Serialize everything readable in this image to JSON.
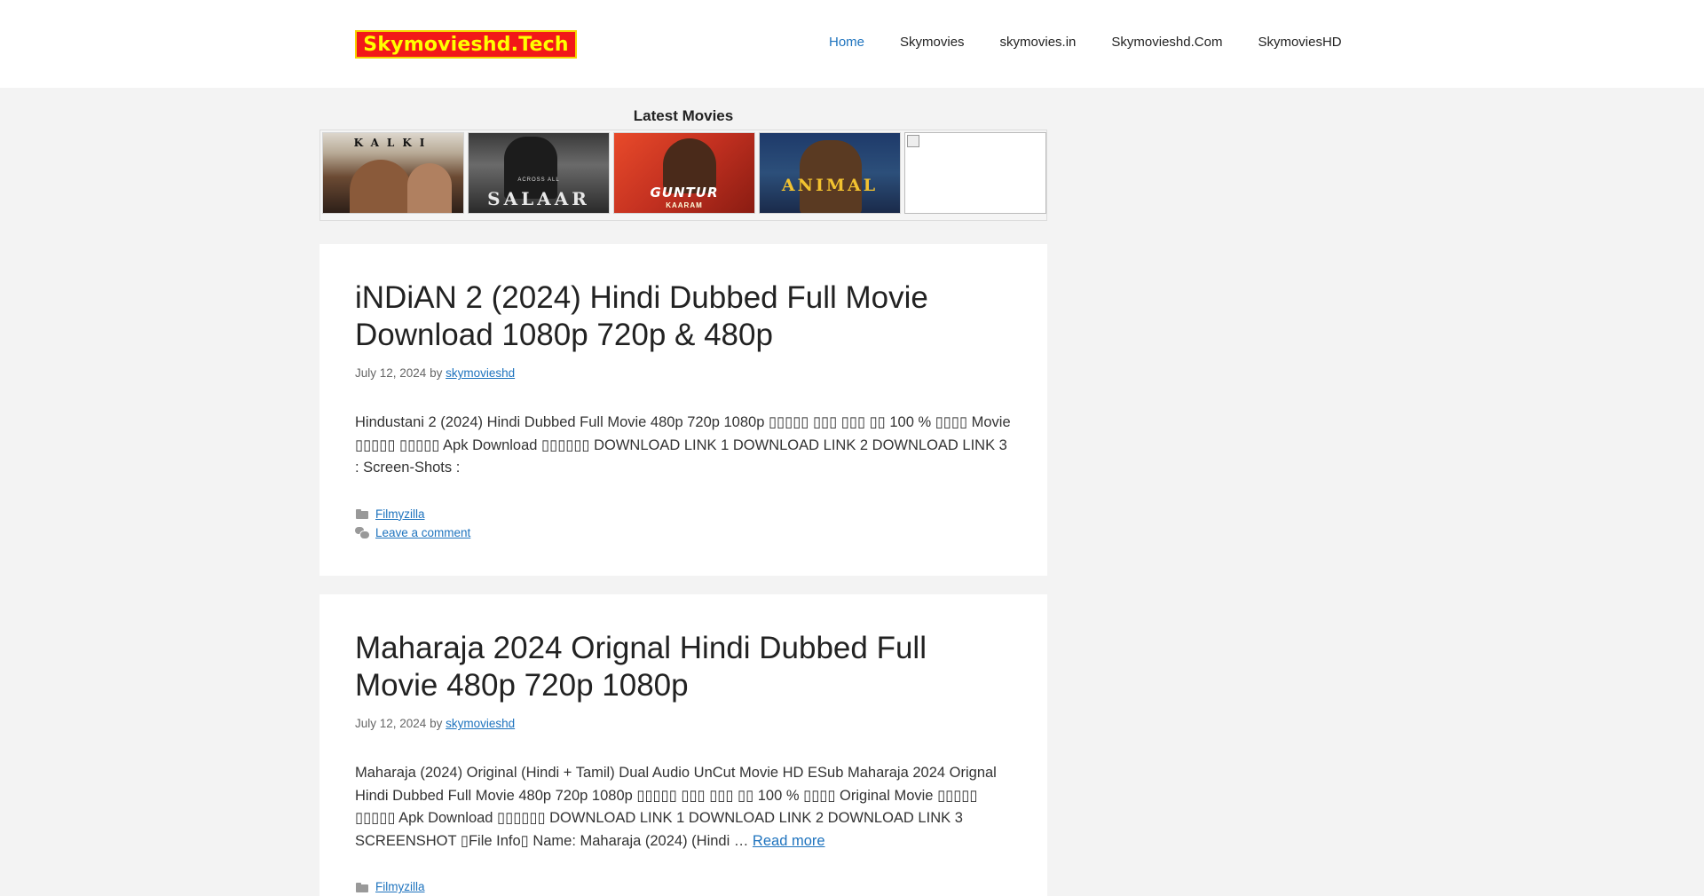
{
  "header": {
    "logo_text": "Skymovieshd.Tech",
    "nav": [
      {
        "label": "Home",
        "active": true
      },
      {
        "label": "Skymovies"
      },
      {
        "label": "skymovies.in"
      },
      {
        "label": "Skymovieshd.Com"
      },
      {
        "label": "SkymoviesHD"
      }
    ]
  },
  "latest": {
    "title": "Latest Movies",
    "posters": [
      {
        "name": "Kalki",
        "text": "KALKI"
      },
      {
        "name": "Salaar",
        "text": "SALAAR",
        "tagline": "ACROSS ALL"
      },
      {
        "name": "Guntur Kaaram",
        "text": "GUNTUR",
        "sub": "KAARAM"
      },
      {
        "name": "Animal",
        "text": "ANIMAL"
      },
      {
        "name": "broken-image"
      }
    ]
  },
  "posts": [
    {
      "title": "iNDiAN 2 (2024) Hindi Dubbed Full Movie Download 1080p 720p & 480p",
      "date": "July 12, 2024",
      "by": "by",
      "author": "skymovieshd",
      "excerpt": "Hindustani 2 (2024) Hindi Dubbed Full Movie 480p 720p 1080p ▯▯▯▯▯ ▯▯▯ ▯▯▯ ▯▯ 100 % ▯▯▯▯ Movie ▯▯▯▯▯ ▯▯▯▯▯ Apk Download ▯▯▯▯▯▯ DOWNLOAD LINK 1 DOWNLOAD LINK 2  DOWNLOAD LINK 3 : Screen-Shots :",
      "read_more": "",
      "category": "Filmyzilla",
      "comment": "Leave a comment"
    },
    {
      "title": "Maharaja 2024 Orignal Hindi Dubbed Full Movie 480p 720p 1080p",
      "date": "July 12, 2024",
      "by": "by",
      "author": "skymovieshd",
      "excerpt": "Maharaja (2024) Original (Hindi + Tamil) Dual Audio UnCut Movie HD ESub   Maharaja 2024 Orignal Hindi Dubbed Full Movie 480p 720p 1080p ▯▯▯▯▯ ▯▯▯ ▯▯▯ ▯▯ 100 % ▯▯▯▯ Original Movie ▯▯▯▯▯ ▯▯▯▯▯ Apk Download ▯▯▯▯▯▯ DOWNLOAD LINK 1 DOWNLOAD LINK 2  DOWNLOAD LINK 3 SCREENSHOT   ▯File Info▯ Name: Maharaja (2024) (Hindi … ",
      "read_more": "Read more",
      "category": "Filmyzilla",
      "comment": "Leave a comment"
    }
  ]
}
